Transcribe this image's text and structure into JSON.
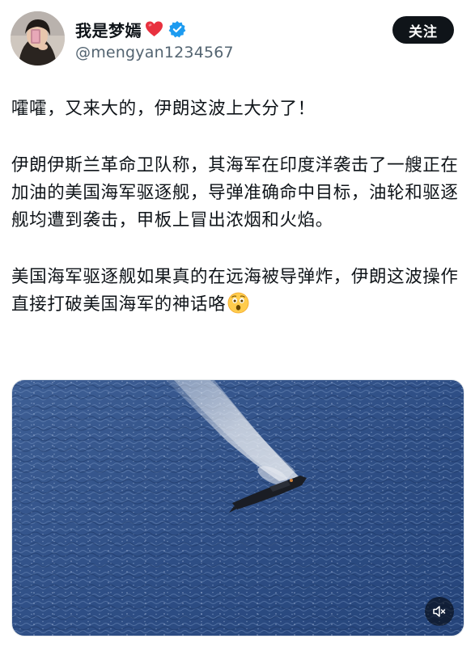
{
  "author": {
    "display_name": "我是梦嫣",
    "handle": "@mengyan1234567",
    "badge_icon": "verified-badge-icon",
    "name_emoji": "red-heart-icon",
    "accent_color": "#1d9bf0"
  },
  "follow_button": {
    "label": "关注"
  },
  "tweet": {
    "paragraphs": [
      "嚯嚯，又来大的，伊朗这波上大分了！",
      "伊朗伊斯兰革命卫队称，其海军在印度洋袭击了一艘正在加油的美国海军驱逐舰，导弹准确命中目标，油轮和驱逐舰均遭到袭击，甲板上冒出浓烟和火焰。",
      "美国海军驱逐舰如果真的在远海被导弹炸，伊朗这波操作直接打破美国海军的神话咯"
    ],
    "trailing_emoji": "astonished-face-icon"
  },
  "media": {
    "type": "video",
    "mute_icon": "speaker-muted-icon"
  }
}
